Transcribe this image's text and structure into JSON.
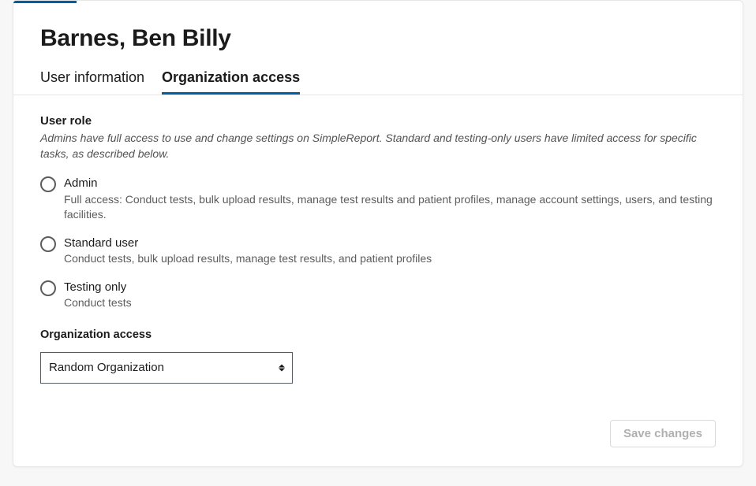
{
  "header": {
    "title": "Barnes, Ben Billy"
  },
  "tabs": [
    {
      "id": "user-information",
      "label": "User information",
      "active": false
    },
    {
      "id": "organization-access",
      "label": "Organization access",
      "active": true
    }
  ],
  "user_role_section": {
    "heading": "User role",
    "description": "Admins have full access to use and change settings on SimpleReport. Standard and testing-only users have limited access for specific tasks, as described below."
  },
  "roles": [
    {
      "id": "admin",
      "label": "Admin",
      "description": "Full access: Conduct tests, bulk upload results, manage test results and patient profiles, manage account settings, users, and testing facilities."
    },
    {
      "id": "standard",
      "label": "Standard user",
      "description": "Conduct tests, bulk upload results, manage test results, and patient profiles"
    },
    {
      "id": "testing",
      "label": "Testing only",
      "description": "Conduct tests"
    }
  ],
  "org_access": {
    "label": "Organization access",
    "selected": "Random Organization"
  },
  "actions": {
    "save_label": "Save changes"
  }
}
